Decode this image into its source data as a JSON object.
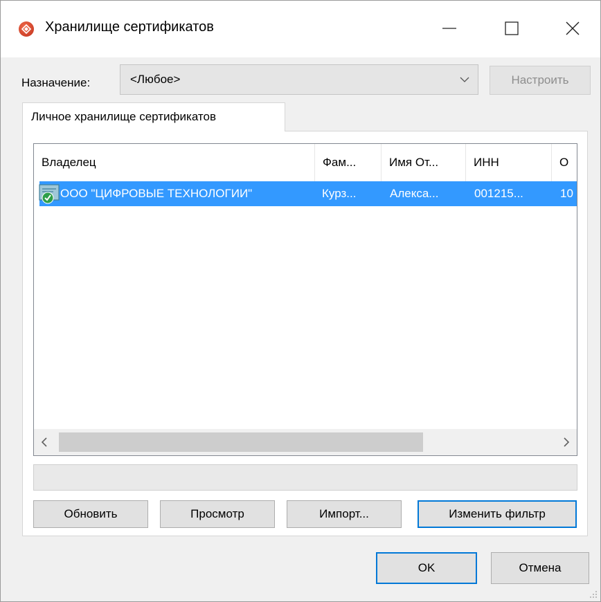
{
  "window": {
    "title": "Хранилище сертификатов",
    "icon": "app-shield-icon"
  },
  "purpose": {
    "label": "Назначение:",
    "selected": "<Любое>",
    "configure_label": "Настроить"
  },
  "tab": {
    "label": "Личное хранилище сертификатов"
  },
  "list": {
    "columns": [
      "Владелец",
      "Фам...",
      "Имя От...",
      "ИНН",
      "О"
    ],
    "rows": [
      {
        "owner": "ООО \"ЦИФРОВЫЕ ТЕХНОЛОГИИ\"",
        "surname": "Курз...",
        "name": "Алекса...",
        "inn": "001215...",
        "extra": "10",
        "icon": "certificate-icon"
      }
    ]
  },
  "buttons": {
    "refresh": "Обновить",
    "view": "Просмотр",
    "import": "Импорт...",
    "change_filter": "Изменить фильтр",
    "ok": "OK",
    "cancel": "Отмена"
  },
  "colors": {
    "selection": "#3399ff",
    "focus_border": "#0078d7",
    "dialog_bg": "#f0f0f0"
  }
}
